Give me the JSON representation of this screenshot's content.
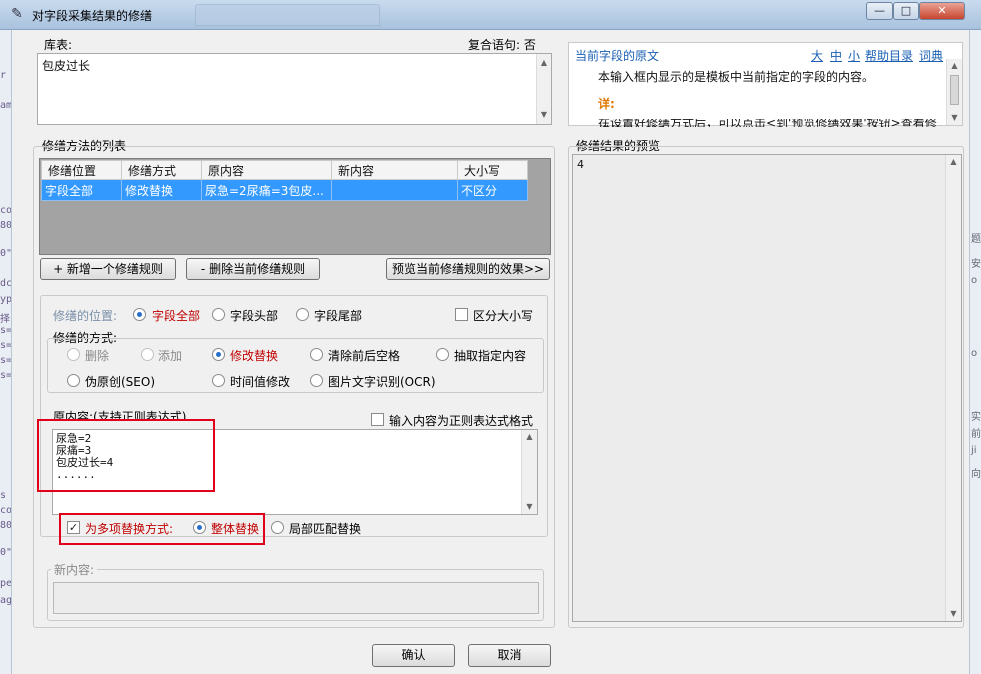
{
  "window": {
    "title": "对字段采集结果的修缮",
    "min_icon": "minimize-icon",
    "max_icon": "maximize-icon",
    "close_icon": "close-icon",
    "min_glyph": "—",
    "max_glyph": "□",
    "close_glyph": "✕"
  },
  "source_table": {
    "label": "库表:",
    "compound_label": "复合语句:",
    "compound_value": "否",
    "value": "包皮过长"
  },
  "original_text_panel": {
    "title": "当前字段的原文",
    "font_large": "大",
    "font_medium": "中",
    "font_small": "小",
    "help": "帮助目录",
    "dictionary": "词典",
    "body_line1": "本输入框内显示的是模板中当前指定的字段的内容。",
    "detail_label": "详:",
    "body_line2": "在设置好修缮方式后，可以点击<到'预览修缮效果'按钮>查看修缮结果，输入..."
  },
  "method_list": {
    "label": "修缮方法的列表",
    "columns": [
      "修缮位置",
      "修缮方式",
      "原内容",
      "新内容",
      "大小写"
    ],
    "rows": [
      [
        "字段全部",
        "修改替换",
        "尿急=2尿痛=3包皮...",
        "",
        "不区分"
      ]
    ]
  },
  "buttons": {
    "add_rule": "+ 新增一个修缮规则",
    "delete_rule": "- 删除当前修缮规则",
    "preview_rule": "预览当前修缮规则的效果>>",
    "ok": "确认",
    "cancel": "取消"
  },
  "position": {
    "label": "修缮的位置:",
    "options": [
      "字段全部",
      "字段头部",
      "字段尾部"
    ],
    "selected": "字段全部",
    "case_sensitive": "区分大小写"
  },
  "method": {
    "label": "修缮的方式:",
    "row1": [
      "删除",
      "添加",
      "修改替换",
      "清除前后空格",
      "抽取指定内容"
    ],
    "row2": [
      "伪原创(SEO)",
      "时间值修改",
      "图片文字识别(OCR)"
    ],
    "selected": "修改替换"
  },
  "original_content": {
    "label": "原内容:(支持正则表达式)",
    "regex_checkbox": "输入内容为正则表达式格式",
    "lines": [
      "尿急=2",
      "尿痛=3",
      "包皮过长=4",
      "......"
    ]
  },
  "multi_replace": {
    "label": "为多项替换方式:",
    "option_whole": "整体替换",
    "option_partial": "局部匹配替换"
  },
  "new_content": {
    "label": "新内容:"
  },
  "preview_panel": {
    "label": "修缮结果的预览",
    "value": "4"
  },
  "accent_colors": {
    "selection_blue": "#3399ff",
    "highlight_red": "#e0001a",
    "link_blue": "#1a5fb4"
  }
}
